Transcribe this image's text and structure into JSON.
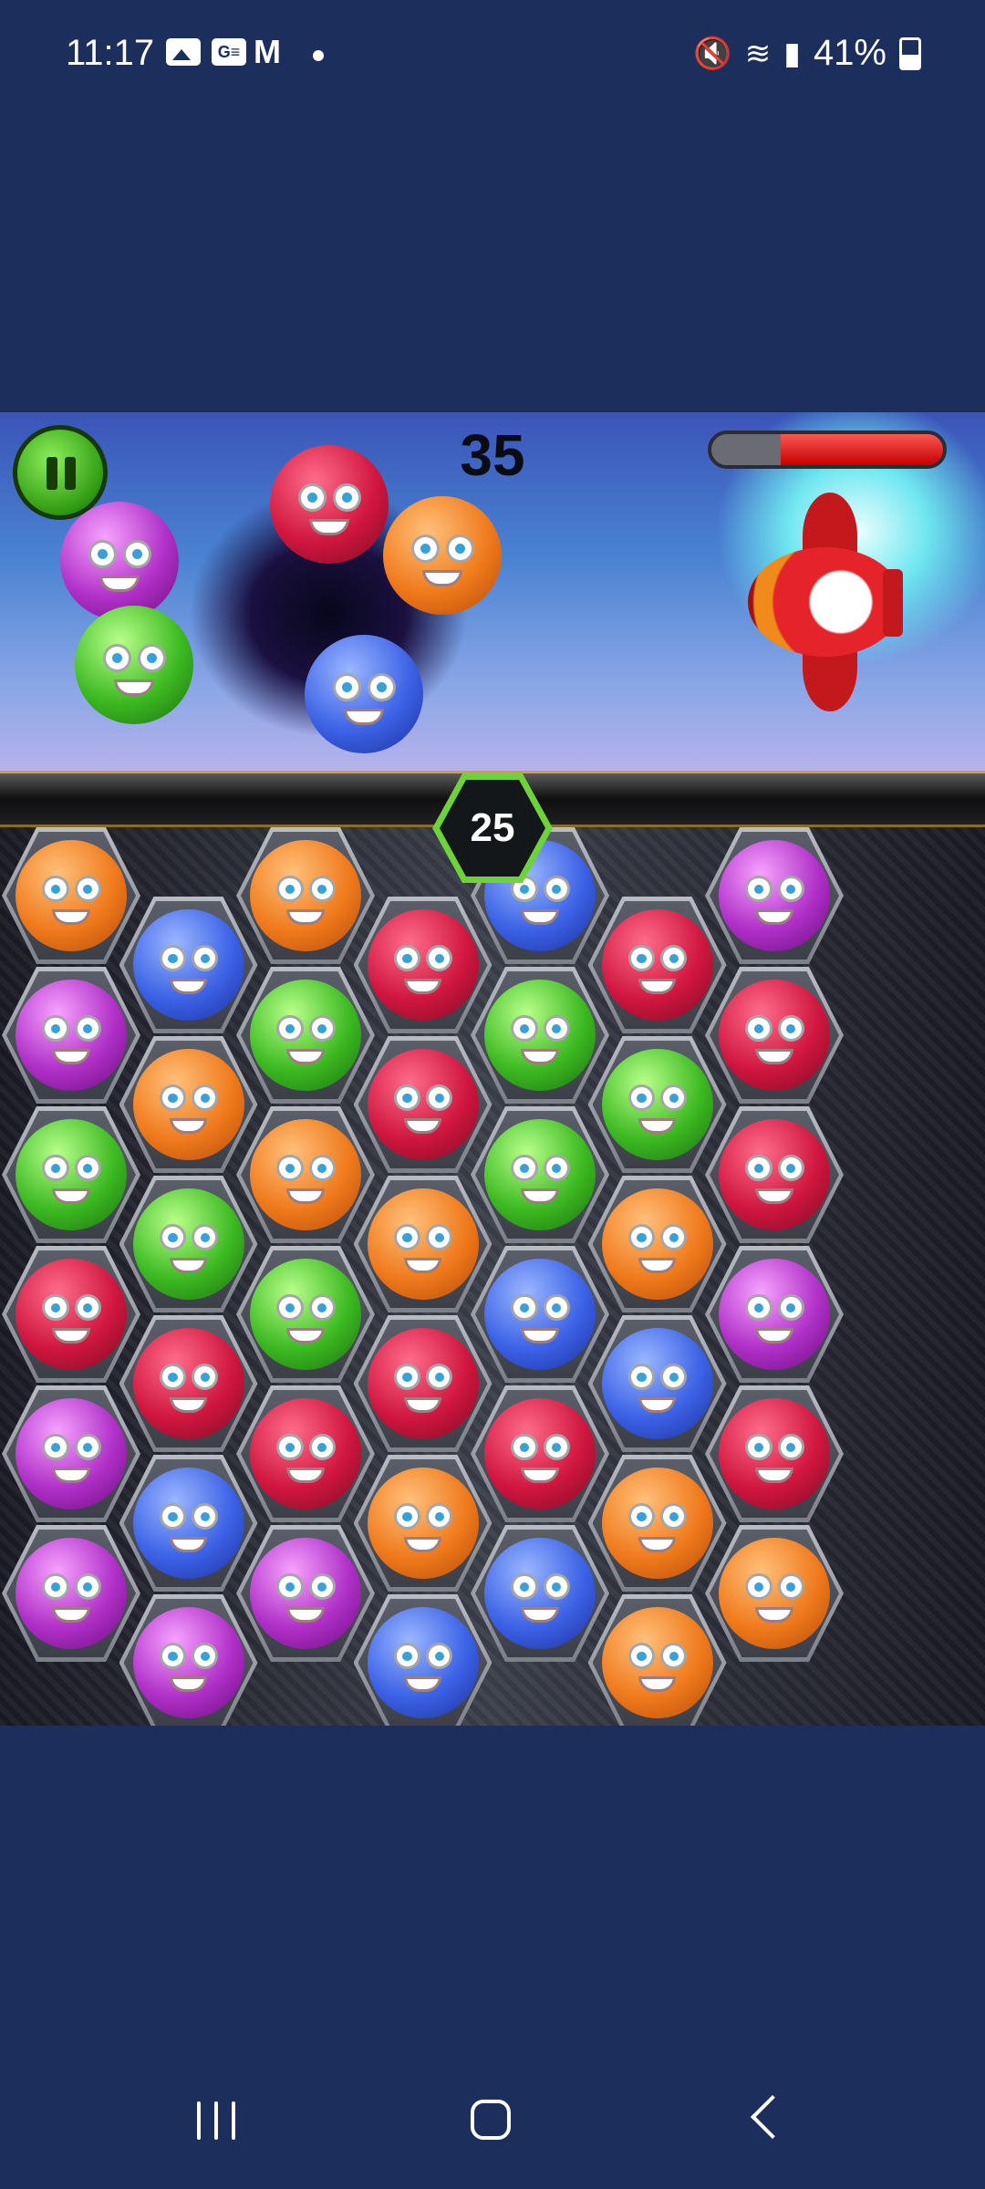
{
  "status_bar": {
    "time": "11:17",
    "notification_icons": [
      "image-icon",
      "gse-icon",
      "gmail-icon"
    ],
    "battery": "41%",
    "right_icons": [
      "mute-icon",
      "wifi-icon",
      "signal-icon",
      "battery-icon"
    ]
  },
  "game": {
    "score": "35",
    "moves_left": "25",
    "health_fraction": 0.7,
    "colors": {
      "orange": "#f07a1c",
      "blue": "#3c62e6",
      "red": "#d0163f",
      "green": "#3dba22",
      "purple": "#b030c8"
    },
    "floating_monsters": [
      "purple",
      "red",
      "orange",
      "green",
      "blue"
    ],
    "board_columns": [
      [
        "orange",
        "purple",
        "green",
        "red",
        "purple",
        "purple"
      ],
      [
        "blue",
        "orange",
        "green",
        "red",
        "blue",
        "purple"
      ],
      [
        "orange",
        "green",
        "orange",
        "green",
        "red",
        "purple"
      ],
      [
        "red",
        "red",
        "orange",
        "red",
        "orange",
        "blue"
      ],
      [
        "blue",
        "green",
        "green",
        "blue",
        "red",
        "blue"
      ],
      [
        "red",
        "green",
        "orange",
        "blue",
        "orange",
        "orange"
      ],
      [
        "purple",
        "red",
        "red",
        "purple",
        "red",
        "orange"
      ]
    ]
  },
  "nav_bar": {
    "buttons": [
      "recent-apps-icon",
      "home-icon",
      "back-icon"
    ]
  }
}
